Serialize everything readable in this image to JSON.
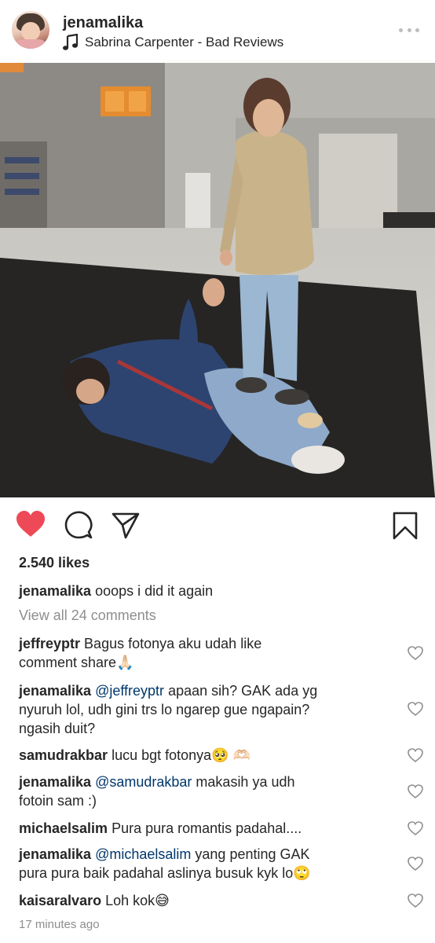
{
  "post": {
    "username": "jenamalika",
    "song": "Sabrina Carpenter - Bad Reviews",
    "more_icon": "more-dots-icon",
    "music_icon": "music-note-icon"
  },
  "actions": {
    "like_icon": "heart-filled-icon",
    "comment_icon": "comment-bubble-icon",
    "share_icon": "paper-plane-icon",
    "save_icon": "bookmark-icon",
    "like_color": "#ed4956"
  },
  "likes": "2.540 likes",
  "caption": {
    "username": "jenamalika",
    "text": "ooops i did it again"
  },
  "view_all": "View all 24 comments",
  "comments": [
    {
      "username": "jeffreyptr",
      "line1": "Bagus fotonya aku udah like",
      "line2": "comment share🙏🏻"
    },
    {
      "username": "jenamalika",
      "mention": "@jeffreyptr",
      "line1": "apaan sih? GAK ada yg",
      "line2": "nyuruh lol, udh gini trs lo ngarep gue ngapain?",
      "line3": "ngasih duit?"
    },
    {
      "username": "samudrakbar",
      "line1": "lucu bgt fotonya🥺 🫶🏻"
    },
    {
      "username": "jenamalika",
      "mention": "@samudrakbar",
      "line1": "makasih ya udh",
      "line2": "fotoin sam :)"
    },
    {
      "username": "michaelsalim",
      "line1": "Pura pura romantis padahal...."
    },
    {
      "username": "jenamalika",
      "mention": "@michaelsalim",
      "line1": "yang penting GAK",
      "line2": "pura pura baik padahal aslinya busuk kyk lo🙄"
    },
    {
      "username": "kaisaralvaro",
      "line1": "Loh kok😅"
    }
  ],
  "timestamp": "17 minutes ago"
}
